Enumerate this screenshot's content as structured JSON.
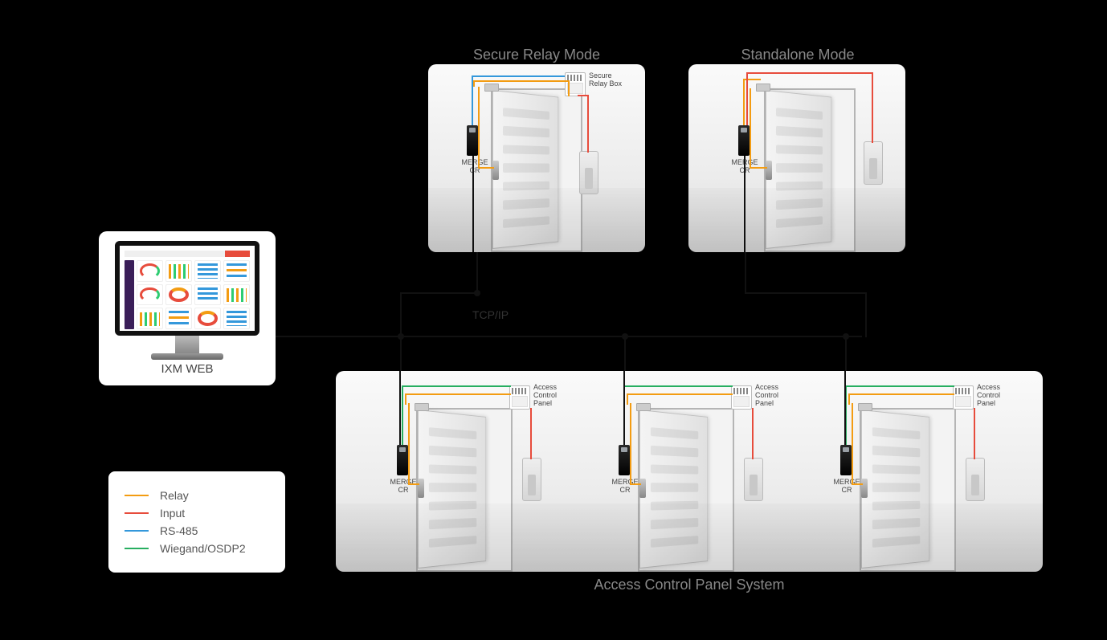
{
  "titles": {
    "secure_relay_mode": "Secure Relay Mode",
    "standalone_mode": "Standalone Mode",
    "acps": "Access Control Panel System"
  },
  "bus_label": "TCP/IP",
  "monitor_label": "IXM WEB",
  "legend": {
    "relay": "Relay",
    "input": "Input",
    "rs485": "RS-485",
    "wiegand": "Wiegand/OSDP2"
  },
  "device_labels": {
    "merge_cr": "MERGE\nCR",
    "secure_relay_box": "Secure\nRelay Box",
    "access_control_panel": "Access\nControl\nPanel"
  },
  "colors": {
    "relay": "#f39c12",
    "input": "#e74c3c",
    "rs485": "#3498db",
    "wiegand": "#27ae60"
  },
  "chart_data": {
    "type": "diagram",
    "description": "Network/wiring topology diagram for an access control product. Three deployment modes are shown: Secure Relay Mode, Standalone Mode, and Access Control Panel System. All door readers (MERGE CR) connect to an IXM WEB management workstation over a TCP/IP bus. Each door scene depicts a door with a MERGE CR reader, a door-position sensor, a strike, and an exit device. Wire colors denote signal type per legend.",
    "legend": {
      "Relay": "#f39c12",
      "Input": "#e74c3c",
      "RS-485": "#3498db",
      "Wiegand/OSDP2": "#27ae60"
    },
    "tcpip_bus": {
      "connects": [
        "IXM WEB workstation",
        "Secure Relay Mode door",
        "Standalone Mode door",
        "ACPS door 1",
        "ACPS door 2",
        "ACPS door 3"
      ]
    },
    "modes": [
      {
        "name": "Secure Relay Mode",
        "doors": 1,
        "extra_components": [
          "Secure Relay Box"
        ],
        "wires_from_reader": [
          {
            "to": "Secure Relay Box",
            "type": "RS-485"
          },
          {
            "to": "door sensor",
            "type": "Relay",
            "note": "via Secure Relay Box"
          },
          {
            "to": "door strike",
            "type": "Relay",
            "note": "via Secure Relay Box"
          },
          {
            "to": "exit device",
            "type": "Input",
            "note": "via Secure Relay Box"
          }
        ]
      },
      {
        "name": "Standalone Mode",
        "doors": 1,
        "extra_components": [],
        "wires_from_reader": [
          {
            "to": "door sensor",
            "type": "Relay"
          },
          {
            "to": "door strike",
            "type": "Relay"
          },
          {
            "to": "exit device",
            "type": "Input"
          }
        ]
      },
      {
        "name": "Access Control Panel System",
        "doors": 3,
        "extra_components": [
          "Access Control Panel (x3)"
        ],
        "wires_from_reader": [
          {
            "to": "Access Control Panel",
            "type": "Wiegand/OSDP2"
          },
          {
            "to": "door sensor",
            "type": "Relay",
            "note": "via panel"
          },
          {
            "to": "door strike",
            "type": "Relay",
            "note": "via panel"
          },
          {
            "to": "exit device",
            "type": "Input",
            "note": "via panel"
          }
        ]
      }
    ]
  }
}
